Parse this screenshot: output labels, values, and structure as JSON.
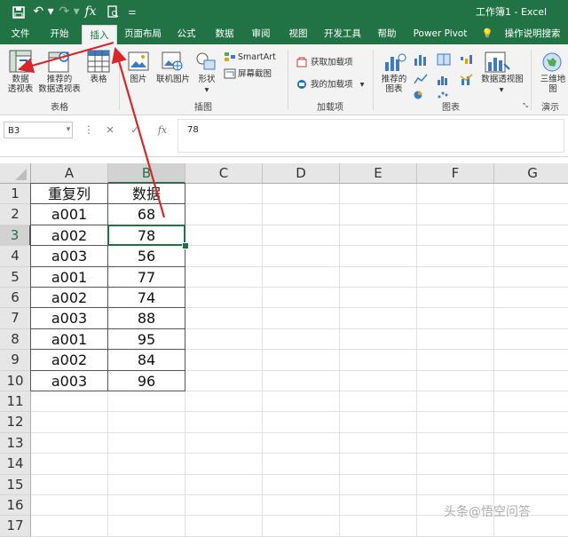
{
  "title_bar": {
    "doc_title": "工作簿1 - Excel",
    "qat": [
      "save-icon",
      "undo-icon",
      "redo-icon",
      "fx-icon",
      "print-preview-icon",
      "customize-icon"
    ]
  },
  "tabs": [
    "文件",
    "开始",
    "插入",
    "页面布局",
    "公式",
    "数据",
    "审阅",
    "视图",
    "开发工具",
    "帮助",
    "Power Pivot",
    "操作说明搜索"
  ],
  "active_tab": "插入",
  "ribbon": {
    "groups": [
      "表格",
      "插图",
      "加载项",
      "图表",
      "演示"
    ],
    "buttons": {
      "pivot": "数据\n透视表",
      "recommended_pivot": "推荐的\n数据透视表",
      "table": "表格",
      "picture": "图片",
      "online_picture": "联机图片",
      "shapes": "形状",
      "smartart": "SmartArt",
      "screenshot": "屏幕截图",
      "get_addins": "获取加载项",
      "my_addins": "我的加载项",
      "recommended_charts": "推荐的\n图表",
      "pivot_chart": "数据透视图",
      "map3d": "三维地\n图"
    }
  },
  "formula_bar": {
    "name_box": "B3",
    "value": "78"
  },
  "columns": [
    "A",
    "B",
    "C",
    "D",
    "E",
    "F",
    "G"
  ],
  "rows": [
    "1",
    "2",
    "3",
    "4",
    "5",
    "6",
    "7",
    "8",
    "9",
    "10",
    "11",
    "12",
    "13",
    "14",
    "15",
    "16",
    "17"
  ],
  "cells": [
    [
      "重复列",
      "数据"
    ],
    [
      "a001",
      "68"
    ],
    [
      "a002",
      "78"
    ],
    [
      "a003",
      "56"
    ],
    [
      "a001",
      "77"
    ],
    [
      "a002",
      "74"
    ],
    [
      "a003",
      "88"
    ],
    [
      "a001",
      "95"
    ],
    [
      "a002",
      "84"
    ],
    [
      "a003",
      "96"
    ]
  ],
  "selected_cell": "B3",
  "watermark": "头条@悟空问答",
  "colors": {
    "excel_green": "#217346",
    "arrow_red": "#d9262b"
  }
}
